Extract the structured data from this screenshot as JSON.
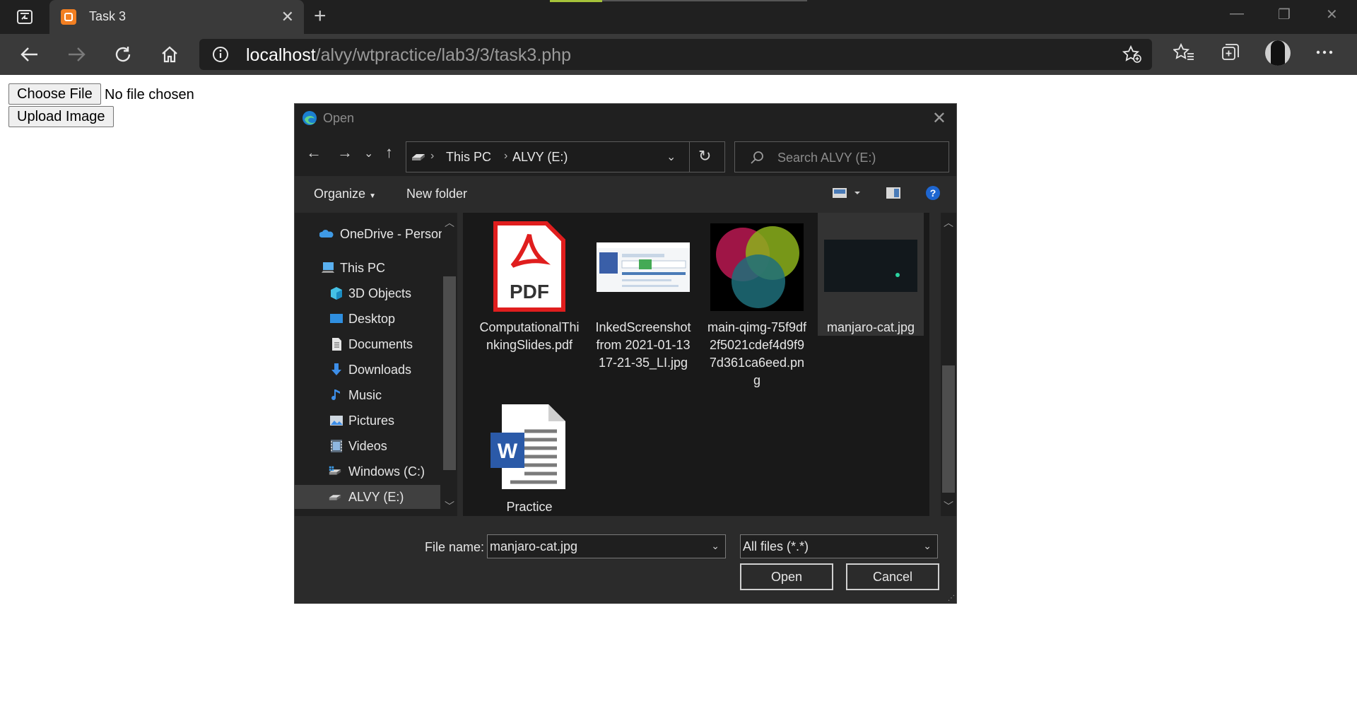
{
  "browser": {
    "tab_title": "Task 3",
    "new_tab": "+",
    "url_host": "localhost",
    "url_path": "/alvy/wtpractice/lab3/3/task3.php"
  },
  "page": {
    "choose_file_label": "Choose File",
    "no_file_text": "No file chosen",
    "upload_label": "Upload Image"
  },
  "dialog": {
    "title": "Open",
    "breadcrumb": [
      "This PC",
      "ALVY (E:)"
    ],
    "search_placeholder": "Search ALVY (E:)",
    "organize_label": "Organize",
    "new_folder_label": "New folder",
    "sidebar": [
      {
        "label": "OneDrive - Person",
        "icon": "onedrive-icon",
        "selected": false
      },
      {
        "label": "This PC",
        "icon": "computer-icon",
        "selected": false
      },
      {
        "label": "3D Objects",
        "icon": "cube-icon",
        "selected": false
      },
      {
        "label": "Desktop",
        "icon": "desktop-icon",
        "selected": false
      },
      {
        "label": "Documents",
        "icon": "document-icon",
        "selected": false
      },
      {
        "label": "Downloads",
        "icon": "download-icon",
        "selected": false
      },
      {
        "label": "Music",
        "icon": "music-icon",
        "selected": false
      },
      {
        "label": "Pictures",
        "icon": "pictures-icon",
        "selected": false
      },
      {
        "label": "Videos",
        "icon": "video-icon",
        "selected": false
      },
      {
        "label": "Windows (C:)",
        "icon": "drive-icon",
        "selected": false
      },
      {
        "label": "ALVY (E:)",
        "icon": "drive-icon",
        "selected": true
      }
    ],
    "files": [
      {
        "name": "ComputationalThinkingSlides.pdf",
        "type": "pdf"
      },
      {
        "name": "InkedScreenshot from 2021-01-13 17-21-35_LI.jpg",
        "type": "screenshot"
      },
      {
        "name": "main-qimg-75f9df2f5021cdef4d9f97d361ca6eed.png",
        "type": "venn"
      },
      {
        "name": "manjaro-cat.jpg",
        "type": "dark-image",
        "selected": true
      },
      {
        "name": "Practice",
        "type": "word"
      }
    ],
    "file_name_label": "File name:",
    "file_name_value": "manjaro-cat.jpg",
    "file_type_value": "All files (*.*)",
    "open_label": "Open",
    "cancel_label": "Cancel"
  }
}
